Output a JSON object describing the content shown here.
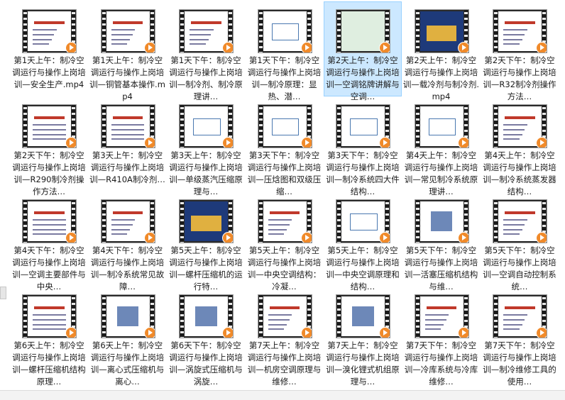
{
  "files": [
    {
      "label": "第1天上午：制冷空调运行与操作上岗培训—安全生产.mp4",
      "thumb": "doc"
    },
    {
      "label": "第1天上午：制冷空调运行与操作上岗培训—铜管基本操作.mp4",
      "thumb": "doc"
    },
    {
      "label": "第1天下午：制冷空调运行与操作上岗培训—制冷剂、制冷原理讲…",
      "thumb": "doc"
    },
    {
      "label": "第1天下午：制冷空调运行与操作上岗培训—制冷原理：显热、潜…",
      "thumb": "diagram"
    },
    {
      "label": "第2天上午：制冷空调运行与操作上岗培训—空调铭牌讲解与空调…",
      "thumb": "green",
      "selected": true
    },
    {
      "label": "第2天上午：制冷空调运行与操作上岗培训—载冷剂与制冷剂.mp4",
      "thumb": "dark"
    },
    {
      "label": "第2天下午：制冷空调运行与操作上岗培训—R32制冷剂操作方法…",
      "thumb": "doc"
    },
    {
      "label": "第2天下午：制冷空调运行与操作上岗培训—R290制冷剂操作方法…",
      "thumb": "table"
    },
    {
      "label": "第3天上午：制冷空调运行与操作上岗培训—R410A制冷剂…",
      "thumb": "table"
    },
    {
      "label": "第3天上午：制冷空调运行与操作上岗培训—单级蒸汽压缩原理与…",
      "thumb": "diagram"
    },
    {
      "label": "第3天下午：制冷空调运行与操作上岗培训—压焓图和双级压缩…",
      "thumb": "chart"
    },
    {
      "label": "第3天下午：制冷空调运行与操作上岗培训—制冷系统四大件结构…",
      "thumb": "diagram"
    },
    {
      "label": "第4天上午：制冷空调运行与操作上岗培训—常见制冷系统原理讲…",
      "thumb": "diagram"
    },
    {
      "label": "第4天上午：制冷空调运行与操作上岗培训—制冷系统蒸发器结构…",
      "thumb": "doc"
    },
    {
      "label": "第4天下午：制冷空调运行与操作上岗培训—空调主要部件与中央…",
      "thumb": "table"
    },
    {
      "label": "第4天下午：制冷空调运行与操作上岗培训—制冷系统常见故障…",
      "thumb": "doc"
    },
    {
      "label": "第5天上午：制冷空调运行与操作上岗培训—螺杆压缩机的运行特…",
      "thumb": "dark"
    },
    {
      "label": "第5天上午：制冷空调运行与操作上岗培训—中央空调结构：冷凝…",
      "thumb": "doc"
    },
    {
      "label": "第5天上午：制冷空调运行与操作上岗培训—中央空调原理和结构…",
      "thumb": "diagram"
    },
    {
      "label": "第5天下午：制冷空调运行与操作上岗培训—活塞压缩机结构与维…",
      "thumb": "photo"
    },
    {
      "label": "第5天下午：制冷空调运行与操作上岗培训—空调自动控制系统…",
      "thumb": "doc"
    },
    {
      "label": "第6天上午：制冷空调运行与操作上岗培训—螺杆压缩机结构原理…",
      "thumb": "table"
    },
    {
      "label": "第6天上午：制冷空调运行与操作上岗培训—离心式压缩机与离心…",
      "thumb": "photo"
    },
    {
      "label": "第6天下午：制冷空调运行与操作上岗培训—涡旋式压缩机与涡旋…",
      "thumb": "photo"
    },
    {
      "label": "第7天上午：制冷空调运行与操作上岗培训—机房空调原理与维修…",
      "thumb": "doc"
    },
    {
      "label": "第7天上午：制冷空调运行与操作上岗培训—溴化锂式机组原理与…",
      "thumb": "photo"
    },
    {
      "label": "第7天下午：制冷空调运行与操作上岗培训—冷库系统与冷库维修…",
      "thumb": "doc"
    },
    {
      "label": "第7天下午：制冷空调运行与操作上岗培训—制冷维修工具的使用…",
      "thumb": "doc"
    }
  ],
  "icons": {
    "play": "play-icon"
  },
  "colors": {
    "selected_bg": "#cce8ff",
    "play": "#f08a2a"
  }
}
